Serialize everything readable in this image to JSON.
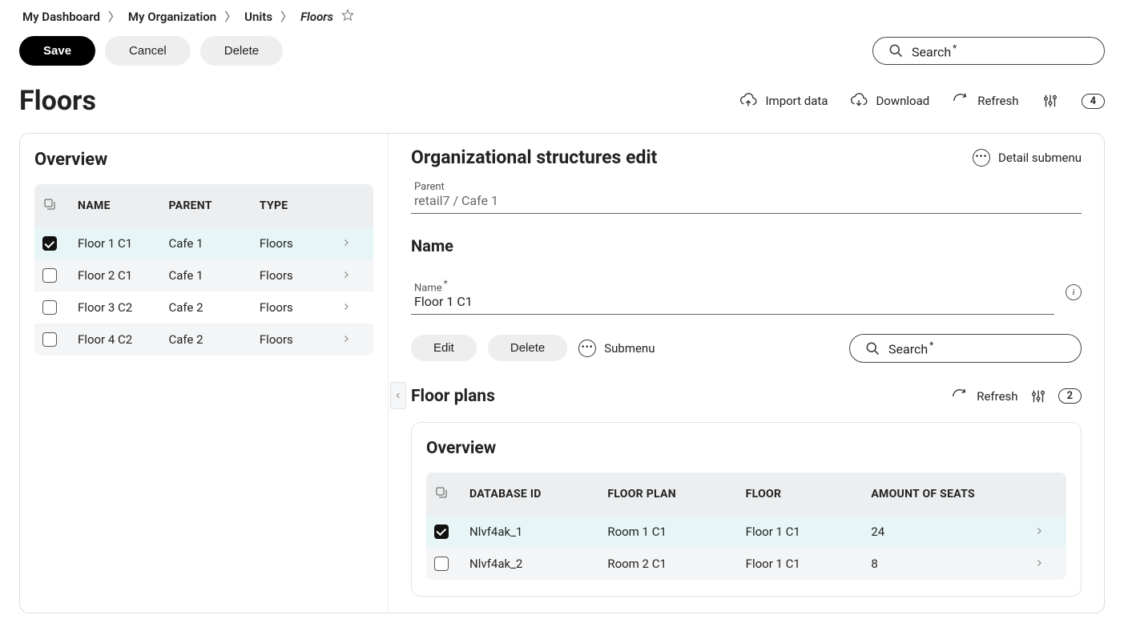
{
  "breadcrumb": [
    "My Dashboard",
    "My Organization",
    "Units",
    "Floors"
  ],
  "buttons": {
    "save": "Save",
    "cancel": "Cancel",
    "delete": "Delete",
    "edit": "Edit"
  },
  "search": {
    "label": "Search",
    "required": "*"
  },
  "page_title": "Floors",
  "page_actions": {
    "import": "Import data",
    "download": "Download",
    "refresh": "Refresh",
    "count": "4"
  },
  "overview": {
    "title": "Overview",
    "columns": [
      "NAME",
      "PARENT",
      "TYPE"
    ],
    "rows": [
      {
        "checked": true,
        "name": "Floor 1 C1",
        "parent": "Cafe 1",
        "type": "Floors"
      },
      {
        "checked": false,
        "name": "Floor 2 C1",
        "parent": "Cafe 1",
        "type": "Floors"
      },
      {
        "checked": false,
        "name": "Floor 3 C2",
        "parent": "Cafe 2",
        "type": "Floors"
      },
      {
        "checked": false,
        "name": "Floor 4 C2",
        "parent": "Cafe 2",
        "type": "Floors"
      }
    ]
  },
  "detail": {
    "title": "Organizational structures edit",
    "submenu": "Detail submenu",
    "parent_label": "Parent",
    "parent_value": "retail7 / Cafe 1",
    "name_heading": "Name",
    "name_label": "Name",
    "name_value": "Floor 1 C1",
    "submenu_btn": "Submenu"
  },
  "floorplans": {
    "title": "Floor plans",
    "refresh": "Refresh",
    "count": "2",
    "overview": "Overview",
    "columns": [
      "DATABASE ID",
      "FLOOR PLAN",
      "FLOOR",
      "AMOUNT OF SEATS"
    ],
    "rows": [
      {
        "checked": true,
        "id": "Nlvf4ak_1",
        "plan": "Room 1 C1",
        "floor": "Floor 1 C1",
        "seats": "24"
      },
      {
        "checked": false,
        "id": "Nlvf4ak_2",
        "plan": "Room 2 C1",
        "floor": "Floor 1 C1",
        "seats": "8"
      }
    ]
  }
}
